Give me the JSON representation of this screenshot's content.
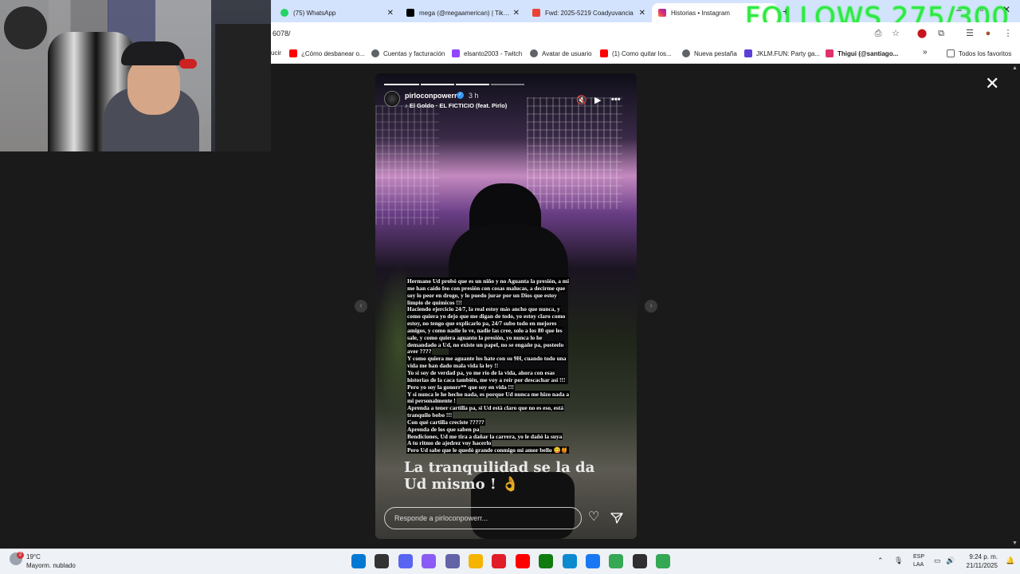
{
  "overlay": {
    "follows_text": "FOLLOWS 275/300"
  },
  "tabs": [
    {
      "label": "(75) WhatsApp",
      "icon": "whatsapp-icon",
      "color": "#25d366"
    },
    {
      "label": "mega (@megaamerican) | TikTok",
      "icon": "tiktok-icon",
      "color": "#000000"
    },
    {
      "label": "Fwd: 2025-5219 Coadyuvancia",
      "icon": "gmail-icon",
      "color": "#ea4335"
    },
    {
      "label": "Historias • Instagram",
      "icon": "instagram-icon",
      "color": "#e1306c",
      "active": true
    }
  ],
  "address": {
    "url": "6078/"
  },
  "bookmarks": [
    {
      "label": "ucir",
      "icon": ""
    },
    {
      "label": "¿Cómo desbanear o...",
      "icon": "youtube-icon",
      "color": "#ff0000"
    },
    {
      "label": "Cuentas y facturación",
      "icon": "globe-icon",
      "color": "#5f6368"
    },
    {
      "label": "elsanto2003 - Twitch",
      "icon": "twitch-icon",
      "color": "#9146ff"
    },
    {
      "label": "Avatar de usuario",
      "icon": "globe-icon",
      "color": "#5f6368"
    },
    {
      "label": "(1) Como quitar los...",
      "icon": "youtube-icon",
      "color": "#ff0000"
    },
    {
      "label": "Nueva pestaña",
      "icon": "globe-icon",
      "color": "#5f6368"
    },
    {
      "label": "JKLM.FUN: Party ga...",
      "icon": "jklm-icon",
      "color": "#5b3fd6"
    },
    {
      "label": "Thigui (@santiago...",
      "icon": "instagram-icon",
      "color": "#e1306c"
    },
    {
      "label": "»",
      "icon": ""
    },
    {
      "label": "Todos los favoritos",
      "icon": "folder-icon",
      "color": "#5f6368"
    }
  ],
  "story": {
    "username": "pirloconpowerr",
    "time": "3 h",
    "song": "El Goldo · EL FICTICIO (feat. Pirlo)",
    "caption_lines": [
      "Hermano Ud probó que es un niño y no Aguanta la presión, a mi",
      "me han caído feo con presión con cosas malucas, a decirme que",
      "soy lo peor en drogo, y lo puedo jurar por un Dios que estoy",
      "limpio de químicos !!!",
      "Haciendo ejercicio 24/7, la real estoy más ancho que nunca, y",
      "como quiera yo dejo que me digan de todo, yo estoy claro como",
      "estoy, no tengo que explicarlo pa, 24/7 subo todo en mejores",
      "amigos, y como nadie lo ve, nadie las cree, solo a los 80 que les",
      "sale, y como quiera aguanto la presión, yo nunca lo he",
      "demandado a Ud, no existe un papel, no se engañe pa, posteelo",
      "aver ????",
      "Y como quiera me aguante los hate con su 9H, cuando todo una",
      "vida me han dado mala vida la ley !!",
      "Yo si soy de verdad pa, yo me río de la vida, ahora con esas",
      "historias de la caca también, me voy a reír por descachar así !!!",
      "Pero yo soy la gonorr** que soy en vida !!!",
      "Y si nunca le he hecho nada, es porque Ud nunca me hizo nada a",
      "mi personalmente !",
      "Aprenda a tener cartilla pa, si Ud está claro que no es eso, está",
      "tranquilo bobo !!!",
      "Con qué cartilla creciste ?????",
      "Aprenda de los que saben pa",
      "Bendiciones, Ud me tira a dañar la carrera, yo le dañó la suya",
      "A tu ritmo de ajedrez voy hacerlo",
      "Pero Ud sabe que le quedó grande conmigo mi amor bello 😋🍯"
    ],
    "big_text": "La tranquilidad se la da Ud mismo ! 👌",
    "reply_placeholder": "Responde a pirloconpowerr..."
  },
  "taskbar": {
    "weather_temp": "19°C",
    "weather_desc": "Mayorm. nublado",
    "weather_badge": "2",
    "lang_1": "ESP",
    "lang_2": "LAA",
    "time": "9:24 p. m.",
    "date": "21/11/2025",
    "apps": [
      {
        "name": "windows-start-icon",
        "color": "#0078d4"
      },
      {
        "name": "task-view-icon",
        "color": "#333333"
      },
      {
        "name": "discord-icon",
        "color": "#5865f2"
      },
      {
        "name": "copilot-icon",
        "color": "#8a5cf5"
      },
      {
        "name": "teams-icon",
        "color": "#6264a7"
      },
      {
        "name": "file-explorer-icon",
        "color": "#f4b400"
      },
      {
        "name": "opera-icon",
        "color": "#e11d2a"
      },
      {
        "name": "youtube-icon",
        "color": "#ff0000"
      },
      {
        "name": "gallery-icon",
        "color": "#107c10"
      },
      {
        "name": "edge-icon",
        "color": "#0c8ad0"
      },
      {
        "name": "facebook-icon",
        "color": "#1877f2"
      },
      {
        "name": "chrome-icon",
        "color": "#34a853"
      },
      {
        "name": "obs-icon",
        "color": "#302e31"
      },
      {
        "name": "chrome-alt-icon",
        "color": "#34a853"
      }
    ]
  }
}
